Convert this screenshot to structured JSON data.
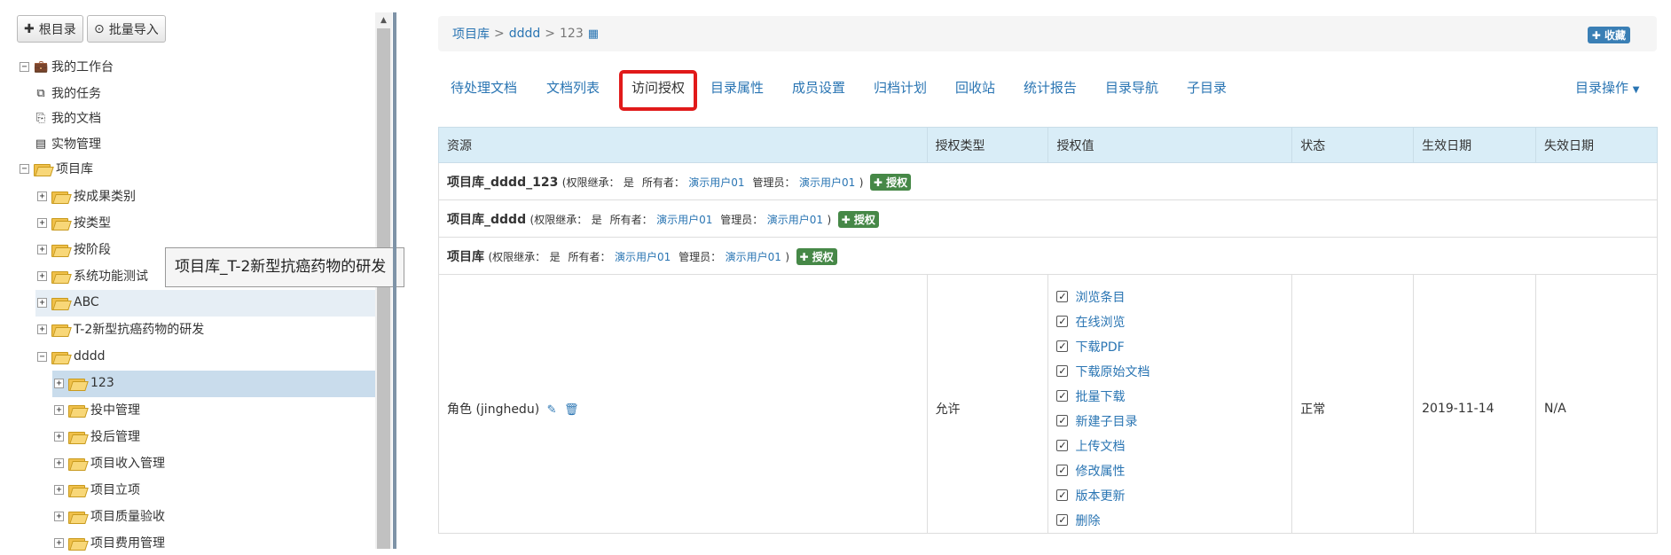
{
  "toolbar": {
    "root_dir": "根目录",
    "batch_import": "批量导入"
  },
  "tree": {
    "workbench": "我的工作台",
    "tasks": "我的任务",
    "docs": "我的文档",
    "physical": "实物管理",
    "project_lib": "项目库",
    "by_result": "按成果类别",
    "by_type": "按类型",
    "by_stage": "按阶段",
    "func_test": "系统功能测试",
    "abc": "ABC",
    "t2": "T-2新型抗癌药物的研发",
    "dddd": "dddd",
    "n123": "123",
    "invest_mid": "投中管理",
    "invest_after": "投后管理",
    "income": "项目收入管理",
    "setup": "项目立项",
    "quality": "项目质量验收",
    "cost": "项目费用管理",
    "tooltip": "项目库_T-2新型抗癌药物的研发"
  },
  "breadcrumb": {
    "lib": "项目库",
    "dddd": "dddd",
    "current": "123",
    "sep": ">",
    "collect": "收藏"
  },
  "tabs": {
    "pending": "待处理文档",
    "doclist": "文档列表",
    "access": "访问授权",
    "props": "目录属性",
    "members": "成员设置",
    "archive": "归档计划",
    "recycle": "回收站",
    "stats": "统计报告",
    "nav": "目录导航",
    "subdir": "子目录",
    "ops": "目录操作"
  },
  "table": {
    "headers": {
      "resource": "资源",
      "type": "授权类型",
      "value": "授权值",
      "status": "状态",
      "start": "生效日期",
      "end": "失效日期"
    },
    "inherit_label": "(权限继承：",
    "inherit_yes": "是",
    "owner_label": "所有者：",
    "admin_label": "管理员：",
    "user": "演示用户01",
    "close_paren": ")",
    "grant": "授权",
    "rows": [
      {
        "name": "项目库_dddd_123"
      },
      {
        "name": "项目库_dddd"
      },
      {
        "name": "项目库"
      }
    ],
    "perm": {
      "role": "角色 (jinghedu)",
      "type": "允许",
      "status": "正常",
      "start": "2019-11-14",
      "end": "N/A",
      "values": [
        "浏览条目",
        "在线浏览",
        "下载PDF",
        "下载原始文档",
        "批量下载",
        "新建子目录",
        "上传文档",
        "修改属性",
        "版本更新",
        "删除"
      ]
    }
  }
}
